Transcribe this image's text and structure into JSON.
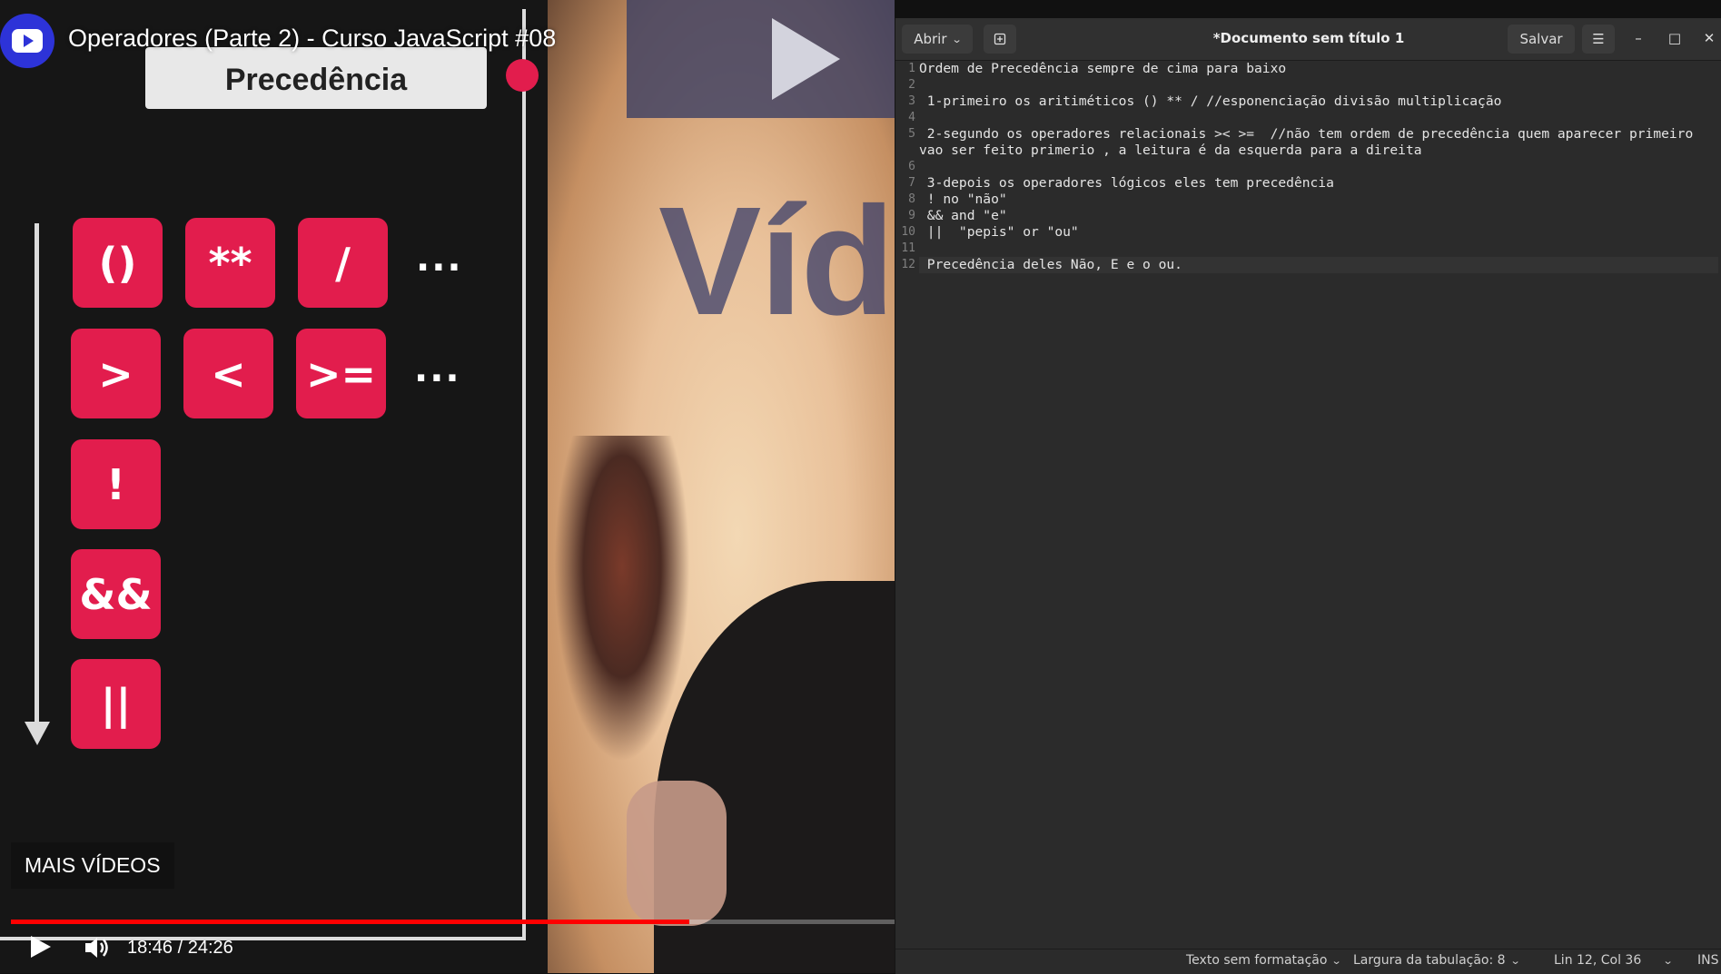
{
  "video": {
    "title": "Operadores (Parte 2) - Curso JavaScript #08",
    "slide_title": "Precedência",
    "bg_word": "Víde",
    "operators_row1": [
      "()",
      "**",
      "/"
    ],
    "operators_row2": [
      ">",
      "<",
      ">="
    ],
    "operators_col": [
      "!",
      "&&",
      "||"
    ],
    "ellipsis": "...",
    "more_videos": "MAIS VÍDEOS",
    "time": "18:46 / 24:26",
    "progress": 0.768,
    "accent": "#e21d4d"
  },
  "editor": {
    "open_label": "Abrir",
    "save_label": "Salvar",
    "title": "*Documento sem título 1",
    "line_numbers": [
      "1",
      "2",
      "3",
      "4",
      "5",
      "",
      "6",
      "7",
      "8",
      "9",
      "10",
      "11",
      "12"
    ],
    "lines": [
      "Ordem de Precedência sempre de cima para baixo",
      "",
      " 1-primeiro os aritiméticos () ** / //esponenciação divisão multiplicação",
      "",
      " 2-segundo os operadores relacionais >< >=  //não tem ordem de precedência quem aparecer primeiro",
      "vao ser feito primerio , a leitura é da esquerda para a direita",
      "",
      " 3-depois os operadores lógicos eles tem precedência",
      " ! no \"não\"",
      " && and \"e\"",
      " ||  \"pepis\" or \"ou\"",
      "",
      " Precedência deles Não, E e o ou."
    ],
    "status": {
      "language": "Texto sem formatação",
      "tab_width": "Largura da tabulação: 8",
      "position": "Lin 12, Col 36",
      "mode": "INS"
    }
  }
}
